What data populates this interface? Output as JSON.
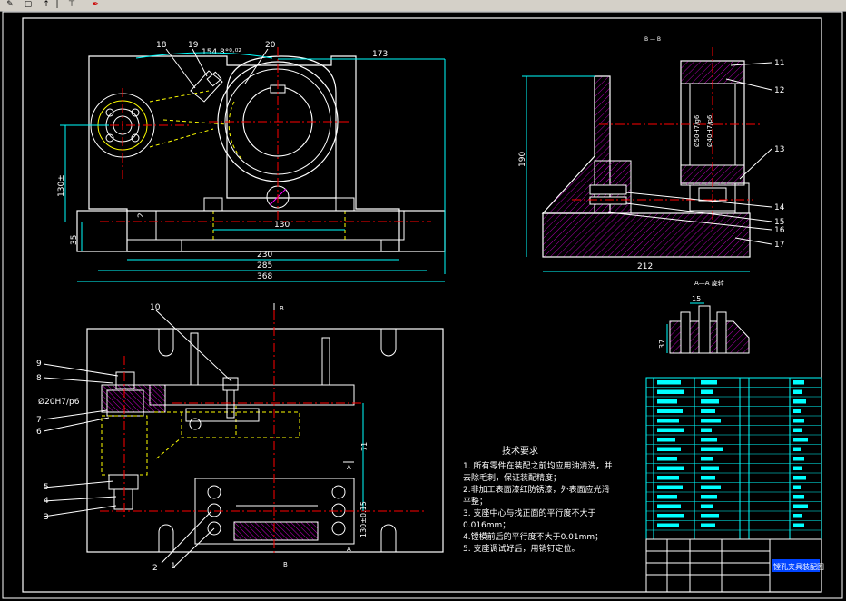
{
  "toolbar": {
    "icons": [
      "draw-icon",
      "shape-icon",
      "arrow-up-icon",
      "separator-icon",
      "tool-icon",
      "pen-icon"
    ]
  },
  "colors": {
    "background": "#000000",
    "line": "#ffffff",
    "dimension": "#00ffff",
    "center": "#ff0000",
    "hidden": "#ffff00",
    "hatch": "#b000b0",
    "part": "#ff00ff",
    "table": "#00ffff"
  },
  "top_view": {
    "dims": {
      "d173": "173",
      "d230": "230",
      "d285": "285",
      "d368": "368",
      "d130": "130",
      "d130v": "130±",
      "d35": "35",
      "d2": "2",
      "angle": "154.8°⁰·⁰²"
    },
    "labels": [
      "18",
      "19",
      "20"
    ]
  },
  "side_view": {
    "section": "B — B",
    "dims": {
      "d190": "190",
      "d212": "212",
      "fit1": "Ø50H7/g6",
      "fit2": "Ø40H7/p6"
    },
    "labels": [
      "11",
      "12",
      "13",
      "14",
      "15",
      "16",
      "17"
    ]
  },
  "section_aa": {
    "title": "A—A  旋转",
    "dims": {
      "d15": "15",
      "d37": "37"
    }
  },
  "plan_view": {
    "labels": [
      "10",
      "9",
      "8",
      "7",
      "6",
      "5",
      "4",
      "3",
      "2",
      "1"
    ],
    "fit": "Ø20H7/p6",
    "dims": {
      "d71": "71",
      "d130": "130±0.15"
    },
    "markA": "A",
    "markB": "B"
  },
  "notes": {
    "title": "技术要求",
    "lines": [
      "1. 所有零件在装配之前均应用油清洗，并",
      "去除毛刺，保证装配精度；",
      "2.非加工表面漆红防锈漆，外表面应光滑",
      "平整；",
      "3. 支座中心与找正面的平行度不大于",
      "0.016mm；",
      "4.镗模前后的平行度不大于0.01mm；",
      "5. 支座调试好后，用销钉定位。"
    ]
  },
  "title_block": {
    "title": "镗孔夹具装配图"
  }
}
